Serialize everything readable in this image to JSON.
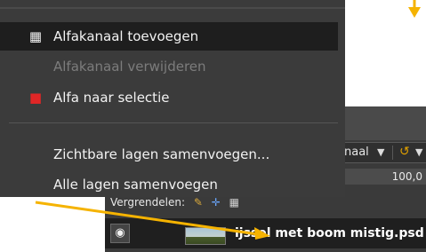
{
  "colors": {
    "menu_bg": "#3b3b3b",
    "menu_hover": "#1e1e1e",
    "menu_disabled_text": "#7c7c7c",
    "arrow": "#f5b301"
  },
  "menu": {
    "items": [
      {
        "label": "Alfakanaal toevoegen",
        "icon": "checkerboard-icon",
        "icon_glyph": "▦",
        "state": "hover"
      },
      {
        "label": "Alfakanaal verwijderen",
        "icon": "",
        "icon_glyph": "",
        "state": "disabled"
      },
      {
        "label": "Alfa naar selectie",
        "icon": "alpha-to-selection-icon",
        "icon_glyph": "■",
        "state": "normal"
      },
      {
        "label": "Zichtbare lagen samenvoegen...",
        "icon": "",
        "icon_glyph": "",
        "state": "normal"
      },
      {
        "label": "Alle lagen samenvoegen",
        "icon": "",
        "icon_glyph": "",
        "state": "normal"
      }
    ]
  },
  "layers_panel": {
    "mode_label": "naal",
    "opacity_value": "100,0",
    "lock_label": "Vergrendelen:",
    "lock_icons": [
      "brush-lock-icon",
      "move-lock-icon",
      "alpha-lock-icon"
    ],
    "layer": {
      "name": "ijssel met boom mistig.psd",
      "visible": true
    }
  }
}
